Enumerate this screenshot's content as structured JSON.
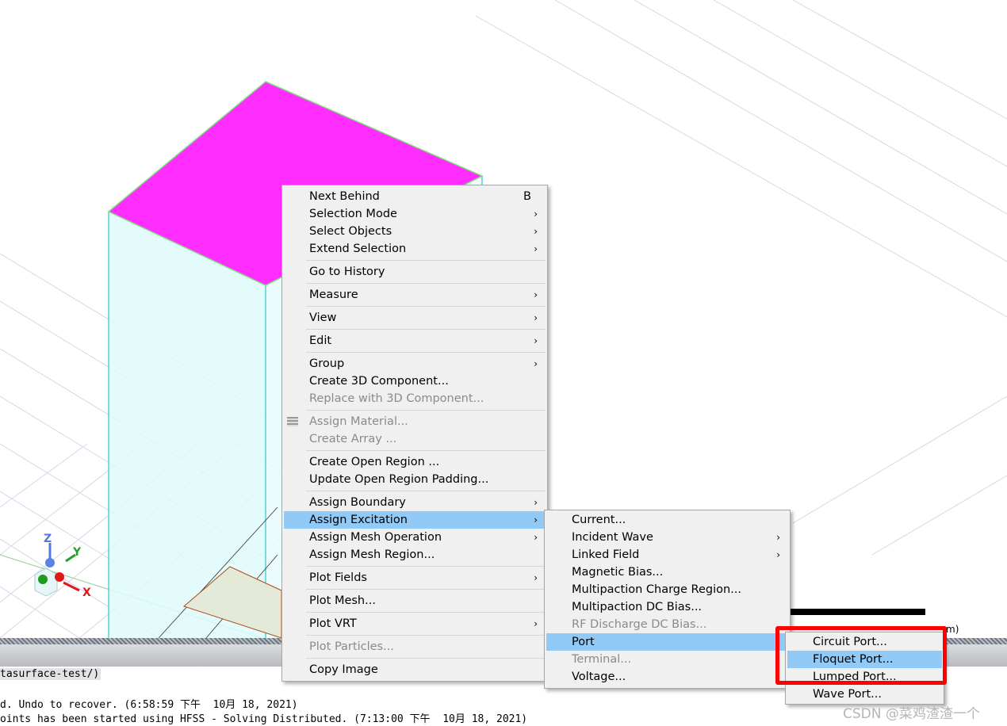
{
  "context_menu": [
    {
      "label": "Next Behind",
      "shortcut": "B"
    },
    {
      "label": "Selection Mode",
      "arrow": true
    },
    {
      "label": "Select Objects",
      "arrow": true
    },
    {
      "label": "Extend Selection",
      "arrow": true
    },
    {
      "sep": true
    },
    {
      "label": "Go to History"
    },
    {
      "sep": true
    },
    {
      "label": "Measure",
      "arrow": true
    },
    {
      "sep": true
    },
    {
      "label": "View",
      "arrow": true
    },
    {
      "sep": true
    },
    {
      "label": "Edit",
      "arrow": true
    },
    {
      "sep": true
    },
    {
      "label": "Group",
      "arrow": true
    },
    {
      "label": "Create 3D Component..."
    },
    {
      "label": "Replace with 3D Component...",
      "disabled": true
    },
    {
      "sep": true
    },
    {
      "label": "Assign Material...",
      "disabled": true,
      "icon": "material-icon"
    },
    {
      "label": "Create Array ...",
      "disabled": true
    },
    {
      "sep": true
    },
    {
      "label": "Create Open Region ..."
    },
    {
      "label": "Update Open Region Padding..."
    },
    {
      "sep": true
    },
    {
      "label": "Assign Boundary",
      "arrow": true
    },
    {
      "label": "Assign Excitation",
      "arrow": true,
      "highlighted": true
    },
    {
      "label": "Assign Mesh Operation",
      "arrow": true
    },
    {
      "label": "Assign Mesh Region..."
    },
    {
      "sep": true
    },
    {
      "label": "Plot Fields",
      "arrow": true
    },
    {
      "sep": true
    },
    {
      "label": "Plot Mesh..."
    },
    {
      "sep": true
    },
    {
      "label": "Plot VRT",
      "arrow": true
    },
    {
      "sep": true
    },
    {
      "label": "Plot Particles...",
      "disabled": true
    },
    {
      "sep": true
    },
    {
      "label": "Copy Image"
    }
  ],
  "excitation_menu": [
    {
      "label": "Current..."
    },
    {
      "label": "Incident Wave",
      "arrow": true
    },
    {
      "label": "Linked Field",
      "arrow": true
    },
    {
      "label": "Magnetic Bias..."
    },
    {
      "label": "Multipaction Charge Region..."
    },
    {
      "label": "Multipaction DC Bias..."
    },
    {
      "label": "RF Discharge DC Bias...",
      "disabled": true
    },
    {
      "label": "Port",
      "arrow": true,
      "highlighted": true
    },
    {
      "label": "Terminal...",
      "disabled": true
    },
    {
      "label": "Voltage..."
    }
  ],
  "port_menu": [
    {
      "label": "Circuit Port..."
    },
    {
      "label": "Floquet Port...",
      "highlighted": true
    },
    {
      "label": "Lumped Port..."
    },
    {
      "label": "Wave Port..."
    }
  ],
  "viewport": {
    "axis_labels": {
      "x": "X",
      "y": "Y",
      "z": "Z"
    },
    "scale_unit_fragment": "m)",
    "colors": {
      "top_face": "#ff2dff",
      "box_edge": "#2ec7c7",
      "box_fill": "#d8fafa",
      "highlight": "#91c9f7",
      "red_box": "#ff0000"
    }
  },
  "message_panel": {
    "project_path_fragment": "tasurface-test/)",
    "lines": [
      "d. Undo to recover. (6:58:59 下午  10月 18, 2021)",
      "oints has been started using HFSS - Solving Distributed. (7:13:00 下午  10月 18, 2021)"
    ]
  },
  "watermark": "CSDN @菜鸡渣渣一个"
}
